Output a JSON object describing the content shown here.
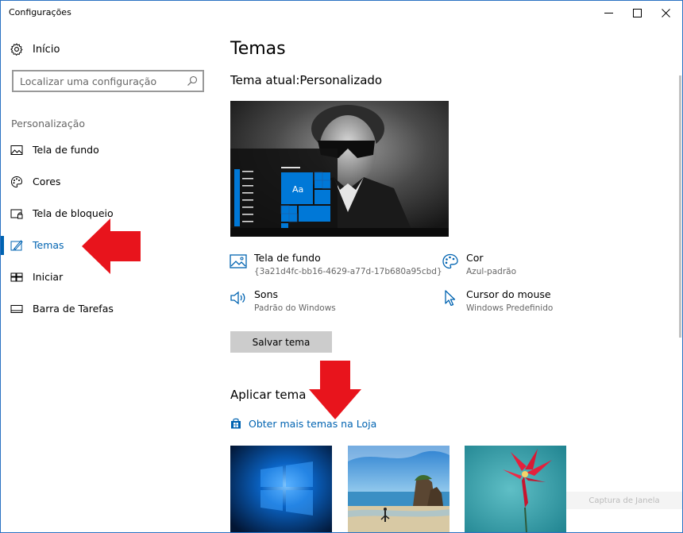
{
  "window": {
    "title": "Configurações"
  },
  "sidebar": {
    "home_label": "Início",
    "search_placeholder": "Localizar uma configuração",
    "section_label": "Personalização",
    "items": [
      {
        "label": "Tela de fundo",
        "icon": "picture-icon"
      },
      {
        "label": "Cores",
        "icon": "palette-icon"
      },
      {
        "label": "Tela de bloqueio",
        "icon": "lock-screen-icon"
      },
      {
        "label": "Temas",
        "icon": "themes-icon",
        "active": true
      },
      {
        "label": "Iniciar",
        "icon": "start-icon"
      },
      {
        "label": "Barra de Tarefas",
        "icon": "taskbar-icon"
      }
    ]
  },
  "main": {
    "title": "Temas",
    "current_theme": "Tema atual:Personalizado",
    "preview_tile_text": "Aa",
    "properties": [
      {
        "name": "Tela de fundo",
        "value": "{3a21d4fc-bb16-4629-a77d-17b680a95cbd}",
        "icon": "picture-icon"
      },
      {
        "name": "Cor",
        "value": "Azul-padrão",
        "icon": "palette-icon"
      },
      {
        "name": "Sons",
        "value": "Padrão do Windows",
        "icon": "speaker-icon"
      },
      {
        "name": "Cursor do mouse",
        "value": "Windows Predefinido",
        "icon": "cursor-icon"
      }
    ],
    "save_button": "Salvar tema",
    "apply_title": "Aplicar tema",
    "store_link": "Obter mais temas na Loja"
  },
  "watermark": "Captura de Janela",
  "colors": {
    "accent": "#0063b1",
    "tile_blue": "#0078d7",
    "arrow_red": "#e8141c"
  }
}
